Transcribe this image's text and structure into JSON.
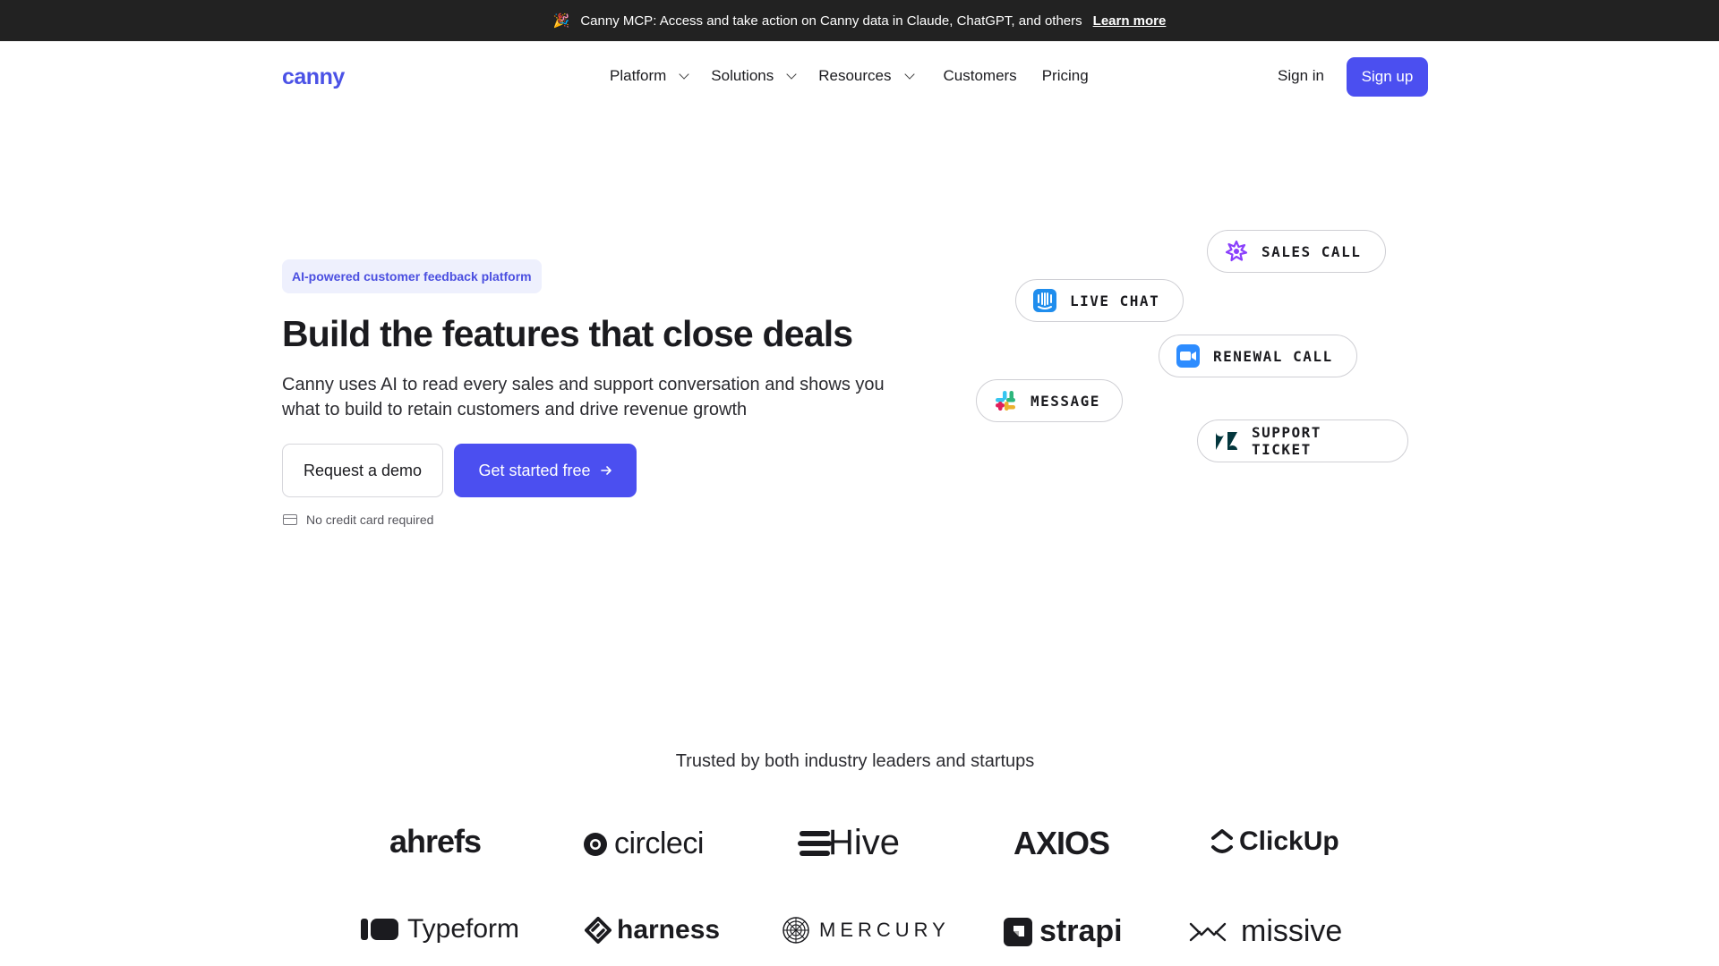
{
  "announcement": {
    "emoji": "🎉",
    "text": "Canny MCP: Access and take action on Canny data in Claude, ChatGPT, and others",
    "link": "Learn more"
  },
  "nav": {
    "logo": "canny",
    "items": [
      {
        "label": "Platform",
        "dropdown": true
      },
      {
        "label": "Solutions",
        "dropdown": true
      },
      {
        "label": "Resources",
        "dropdown": true
      },
      {
        "label": "Customers",
        "dropdown": false
      },
      {
        "label": "Pricing",
        "dropdown": false
      }
    ],
    "sign_in": "Sign in",
    "sign_up": "Sign up"
  },
  "hero": {
    "badge": "AI-powered customer feedback platform",
    "title": "Build the features that close deals",
    "subtitle": "Canny uses AI to read every sales and support conversation and shows you what to build to retain customers and drive revenue growth",
    "demo_button": "Request a demo",
    "start_button": "Get started free",
    "note": "No credit card required"
  },
  "sources": [
    {
      "label": "SALES CALL",
      "icon": "gong-icon"
    },
    {
      "label": "LIVE CHAT",
      "icon": "intercom-icon"
    },
    {
      "label": "RENEWAL CALL",
      "icon": "zoom-icon"
    },
    {
      "label": "MESSAGE",
      "icon": "slack-icon"
    },
    {
      "label": "SUPPORT TICKET",
      "icon": "zendesk-icon"
    }
  ],
  "trusted": {
    "heading": "Trusted by both industry leaders and startups",
    "logos": [
      "ahrefs",
      "circleci",
      "Hive",
      "AXIOS",
      "ClickUp",
      "Typeform",
      "harness",
      "MERCURY",
      "strapi",
      "missive"
    ]
  },
  "colors": {
    "accent": "#4b4ff0",
    "announcement_bg": "#222222",
    "badge_bg": "#eef0fd"
  }
}
